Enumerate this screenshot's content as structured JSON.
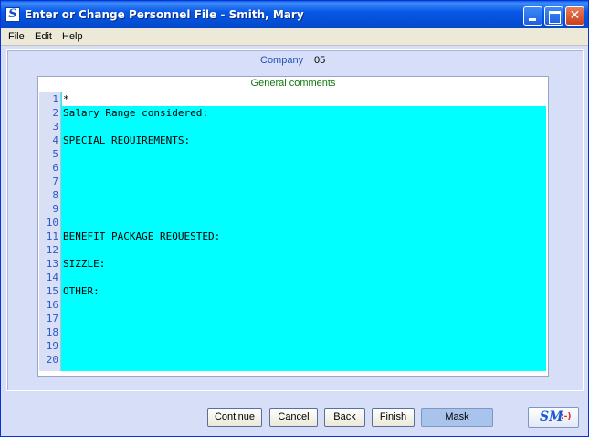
{
  "window": {
    "app_icon": "S",
    "title": "Enter or Change Personnel File - Smith, Mary",
    "controls": {
      "minimize": "minimize-icon",
      "maximize": "maximize-icon",
      "close": "close-icon"
    },
    "close_glyph": "✕"
  },
  "menu": {
    "items": [
      {
        "label": "File"
      },
      {
        "label": "Edit"
      },
      {
        "label": "Help"
      }
    ]
  },
  "company": {
    "label": "Company",
    "value": "05"
  },
  "comments": {
    "header": "General comments",
    "editor_background": "#00ffff",
    "lines": [
      {
        "num": "1",
        "text": "*"
      },
      {
        "num": "2",
        "text": "Salary Range considered:"
      },
      {
        "num": "3",
        "text": ""
      },
      {
        "num": "4",
        "text": "SPECIAL REQUIREMENTS:"
      },
      {
        "num": "5",
        "text": ""
      },
      {
        "num": "6",
        "text": ""
      },
      {
        "num": "7",
        "text": ""
      },
      {
        "num": "8",
        "text": ""
      },
      {
        "num": "9",
        "text": ""
      },
      {
        "num": "10",
        "text": ""
      },
      {
        "num": "11",
        "text": "BENEFIT PACKAGE REQUESTED:"
      },
      {
        "num": "12",
        "text": ""
      },
      {
        "num": "13",
        "text": "SIZZLE:"
      },
      {
        "num": "14",
        "text": ""
      },
      {
        "num": "15",
        "text": "OTHER:"
      },
      {
        "num": "16",
        "text": ""
      },
      {
        "num": "17",
        "text": ""
      },
      {
        "num": "18",
        "text": ""
      },
      {
        "num": "19",
        "text": ""
      },
      {
        "num": "20",
        "text": ""
      }
    ]
  },
  "buttons": {
    "continue": "Continue",
    "cancel": "Cancel",
    "back": "Back",
    "finish": "Finish",
    "mask": "Mask",
    "logo_text": "SM",
    "logo_smile": ":-)"
  },
  "colors": {
    "title_bar": "#0451d8",
    "editor_bg": "#00ffff",
    "header_text": "#117711",
    "label_text": "#2651b8",
    "mask_button": "#a8c4ec"
  }
}
